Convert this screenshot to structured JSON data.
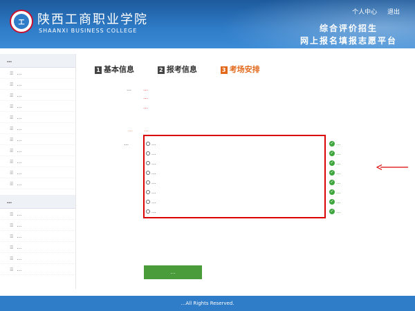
{
  "header": {
    "school_cn": "陕西工商职业学院",
    "school_en": "SHAANXI BUSINESS COLLEGE",
    "logo_text": "工",
    "links": {
      "personal_center": "个人中心",
      "logout": "退出"
    },
    "slogan1": "综合评价招生",
    "slogan2": "网上报名填报志愿平台"
  },
  "sidebar": {
    "section1": "…",
    "items1": [
      "…",
      "…",
      "…",
      "…",
      "…",
      "…",
      "…",
      "…",
      "…",
      "…",
      "…"
    ],
    "section2": "…",
    "items2": [
      "…",
      "…",
      "…",
      "…",
      "…",
      "…"
    ]
  },
  "steps": [
    {
      "num": "1",
      "label": "基本信息"
    },
    {
      "num": "2",
      "label": "报考信息"
    },
    {
      "num": "3",
      "label": "考场安排"
    }
  ],
  "form": {
    "arrangement_label": "…",
    "arrangement_line1": "…",
    "arrangement_line2": "…",
    "arrangement_line3": "…",
    "tip_label": "…",
    "tip_text": "…",
    "slots_label": "…",
    "slots": [
      {
        "text": "…",
        "status": "…"
      },
      {
        "text": "…",
        "status": "…"
      },
      {
        "text": "…",
        "status": "…"
      },
      {
        "text": "…",
        "status": "…"
      },
      {
        "text": "…",
        "status": "…"
      },
      {
        "text": "…",
        "status": "…"
      },
      {
        "text": "…",
        "status": "…"
      },
      {
        "text": "…",
        "status": "…"
      }
    ]
  },
  "save_button": "…",
  "footer": "…All Rights Reserved.",
  "colors": {
    "header_blue": "#2f7cc8",
    "accent_orange": "#e2691b",
    "alert_red": "#dd0000",
    "ok_green": "#2e8b2e",
    "button_green": "#4a9b3a"
  }
}
